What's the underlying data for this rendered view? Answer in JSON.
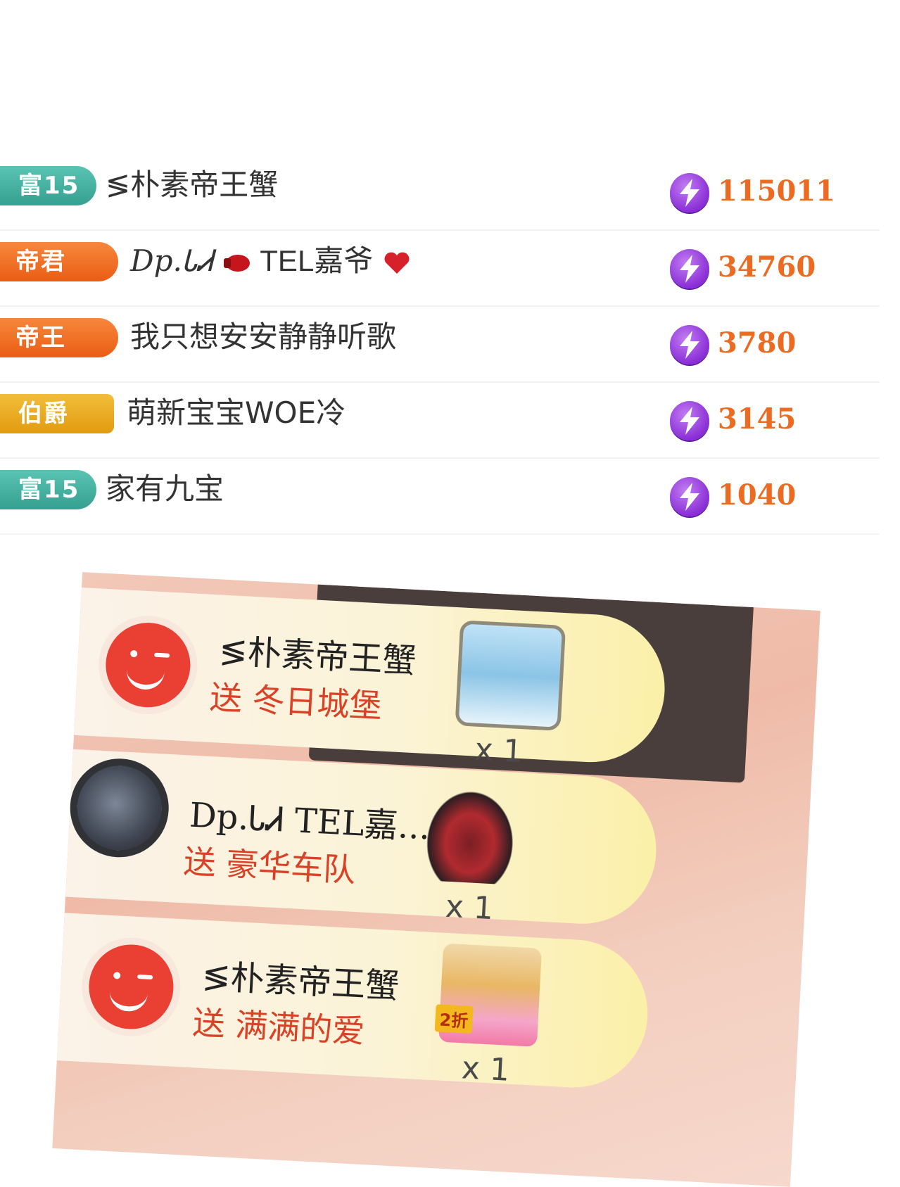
{
  "leaderboard": [
    {
      "badge": "富15",
      "badge_type": "fu",
      "name": "≶朴素帝王蟹",
      "score": "115011"
    },
    {
      "badge": "帝君",
      "badge_type": "dijun",
      "name_prefix": "Dp.ᏓᏗ",
      "name_mid": "TEL嘉爷",
      "score": "34760"
    },
    {
      "badge": "帝王",
      "badge_type": "diwang",
      "name": "我只想安安静静听歌",
      "score": "3780"
    },
    {
      "badge": "伯爵",
      "badge_type": "bojue",
      "name": "萌新宝宝WOE冷",
      "score": "3145"
    },
    {
      "badge": "富15",
      "badge_type": "fu",
      "name": "家有九宝",
      "score": "1040"
    }
  ],
  "gifts": [
    {
      "sender": "≶朴素帝王蟹",
      "action": "送 冬日城堡",
      "count": "x 1",
      "avatar": "smile-avatar",
      "gift_icon": "castle"
    },
    {
      "sender": "Dp.ᏓᏗ TEL嘉...",
      "action": "送 豪华车队",
      "count": "x 1",
      "avatar": "photo-avatar",
      "gift_icon": "car"
    },
    {
      "sender": "≶朴素帝王蟹",
      "action": "送 满满的爱",
      "count": "x 1",
      "avatar": "smile-avatar",
      "gift_icon": "love",
      "gift_tag": "2折"
    }
  ],
  "colors": {
    "fu_badge": "#35a090",
    "di_badge": "#ea5d14",
    "bojue_badge": "#e19c10",
    "score": "#ec6b23",
    "coin": "#8a2fd6",
    "gift_text": "#d94226"
  }
}
